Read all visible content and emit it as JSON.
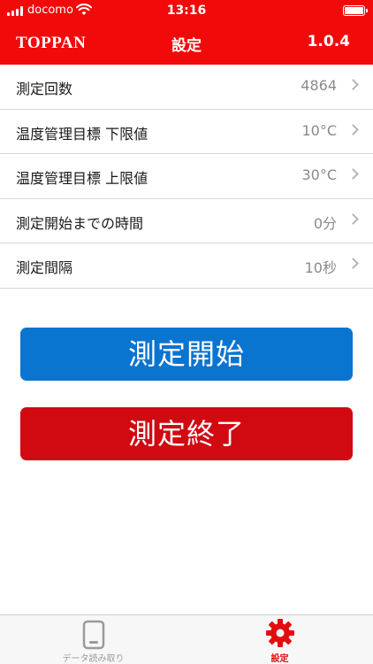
{
  "status_bar": {
    "carrier": "docomo",
    "time": "13:16"
  },
  "header": {
    "brand": "TOPPAN",
    "title": "設定",
    "version": "1.0.4"
  },
  "settings": [
    {
      "label": "測定回数",
      "value": "4864"
    },
    {
      "label": "温度管理目標 下限値",
      "value": "10°C"
    },
    {
      "label": "温度管理目標 上限値",
      "value": "30°C"
    },
    {
      "label": "測定開始までの時間",
      "value": "0分"
    },
    {
      "label": "測定間隔",
      "value": "10秒"
    }
  ],
  "buttons": {
    "start": "測定開始",
    "stop": "測定終了"
  },
  "tabs": [
    {
      "label": "データ読み取り",
      "icon": "phone-icon",
      "active": false
    },
    {
      "label": "設定",
      "icon": "gear-icon",
      "active": true
    }
  ],
  "colors": {
    "header": "#f20a0a",
    "start_button": "#0a74d1",
    "stop_button": "#d10a12",
    "active_tab": "#e30d0d"
  }
}
